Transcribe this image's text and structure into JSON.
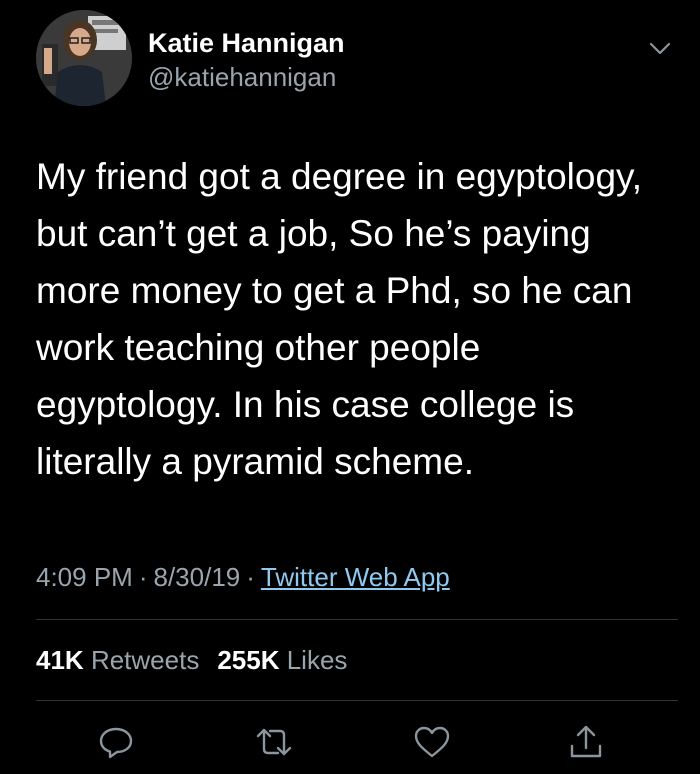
{
  "tweet": {
    "author": {
      "name": "Katie Hannigan",
      "handle": "@katiehannigan",
      "avatar": "profile-photo"
    },
    "menu_icon": "chevron-down-icon",
    "text": "My friend got a degree in egyptology,\nbut can’t get a job, So he’s paying\nmore money to get a Phd, so he can\nwork teaching other people\negyptology.  In his case college is\nliterally a pyramid scheme.",
    "time": "4:09 PM",
    "date": "8/30/19",
    "separator": "·",
    "source": "Twitter Web App",
    "retweets_count": "41K",
    "retweets_label": "Retweets",
    "likes_count": "255K",
    "likes_label": "Likes"
  },
  "actions": [
    {
      "icon": "reply-icon"
    },
    {
      "icon": "retweet-icon"
    },
    {
      "icon": "like-icon"
    },
    {
      "icon": "share-icon"
    }
  ],
  "colors": {
    "background": "#000000",
    "text": "#ffffff",
    "secondary": "#9aa4ad",
    "link": "#8ec9f0",
    "divider": "#2e3338"
  }
}
